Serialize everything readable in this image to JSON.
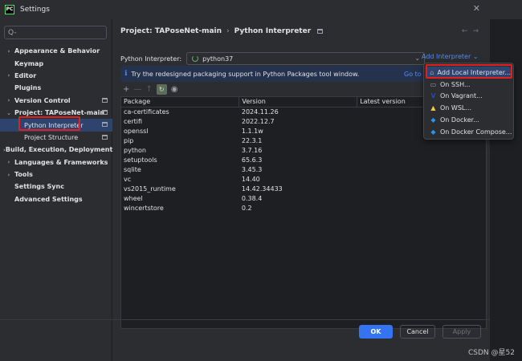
{
  "window": {
    "title": "Settings",
    "close_icon": "close-icon",
    "app_icon_text": "PC"
  },
  "search": {
    "placeholder": "Q-"
  },
  "sidebar": {
    "items": [
      {
        "label": "Appearance & Behavior",
        "arrow": "›",
        "bold": true
      },
      {
        "label": "Keymap",
        "arrow": "",
        "bold": true
      },
      {
        "label": "Editor",
        "arrow": "›",
        "bold": true
      },
      {
        "label": "Plugins",
        "arrow": "",
        "bold": true
      },
      {
        "label": "Version Control",
        "arrow": "›",
        "bold": true
      },
      {
        "label": "Project: TAPoseNet-main",
        "arrow": "⌄",
        "bold": true
      },
      {
        "label": "Python Interpreter",
        "child": true,
        "selected": true
      },
      {
        "label": "Project Structure",
        "child": true
      },
      {
        "label": "Build, Execution, Deployment",
        "arrow": "›",
        "bold": true
      },
      {
        "label": "Languages & Frameworks",
        "arrow": "›",
        "bold": true
      },
      {
        "label": "Tools",
        "arrow": "›",
        "bold": true
      },
      {
        "label": "Settings Sync",
        "arrow": "",
        "bold": true
      },
      {
        "label": "Advanced Settings",
        "arrow": "",
        "bold": true
      }
    ]
  },
  "breadcrumb": {
    "project": "Project: TAPoseNet-main",
    "separator": "›",
    "page": "Python Interpreter"
  },
  "nav": {
    "back": "←",
    "forward": "→"
  },
  "interpreter": {
    "label": "Python Interpreter:",
    "value": "python37",
    "add_label": "Add Interpreter ⌄"
  },
  "banner": {
    "text": "Try the redesigned packaging support in Python Packages tool window.",
    "link": "Go to"
  },
  "toolbar": {
    "add": "+",
    "remove": "—",
    "upgrade": "↑",
    "refresh": "↻",
    "eye": "◉"
  },
  "table": {
    "headers": [
      "Package",
      "Version",
      "Latest version"
    ],
    "rows": [
      [
        "ca-certificates",
        "2024.11.26",
        ""
      ],
      [
        "certifi",
        "2022.12.7",
        ""
      ],
      [
        "openssl",
        "1.1.1w",
        ""
      ],
      [
        "pip",
        "22.3.1",
        ""
      ],
      [
        "python",
        "3.7.16",
        ""
      ],
      [
        "setuptools",
        "65.6.3",
        ""
      ],
      [
        "sqlite",
        "3.45.3",
        ""
      ],
      [
        "vc",
        "14.40",
        ""
      ],
      [
        "vs2015_runtime",
        "14.42.34433",
        ""
      ],
      [
        "wheel",
        "0.38.4",
        ""
      ],
      [
        "wincertstore",
        "0.2",
        ""
      ]
    ]
  },
  "dropdown": {
    "items": [
      {
        "label": "Add Local Interpreter...",
        "icon": "⌂"
      },
      {
        "label": "On SSH...",
        "icon": "▭"
      },
      {
        "label": "On Vagrant...",
        "icon": "V"
      },
      {
        "label": "On WSL...",
        "icon": "▲"
      },
      {
        "label": "On Docker...",
        "icon": "◆"
      },
      {
        "label": "On Docker Compose...",
        "icon": "◆"
      }
    ]
  },
  "buttons": {
    "help": "?",
    "ok": "OK",
    "cancel": "Cancel",
    "apply": "Apply"
  },
  "watermark": "CSDN @星52",
  "colors": {
    "accent": "#3574f0",
    "highlight": "#e02020",
    "link": "#548af7",
    "selection": "#2e436e"
  }
}
